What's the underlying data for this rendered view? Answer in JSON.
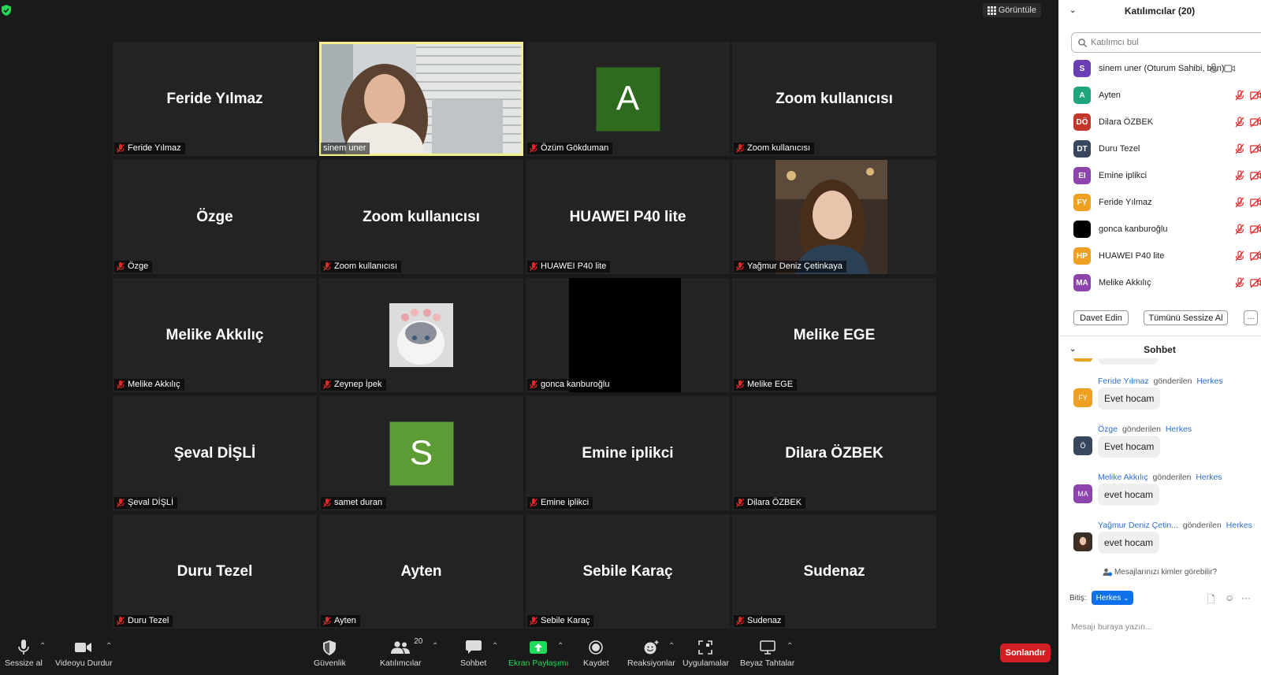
{
  "meeting": {
    "view_label": "Görüntüle",
    "tiles": [
      {
        "display": "Feride Yılmaz",
        "label": "Feride Yılmaz",
        "muted": true,
        "kind": "name"
      },
      {
        "display": "",
        "label": "sinem uner",
        "muted": false,
        "kind": "video",
        "active": true
      },
      {
        "display": "A",
        "label": "Özüm Gökduman",
        "muted": true,
        "kind": "letter",
        "color": "#2f6b1f"
      },
      {
        "display": "Zoom kullanıcısı",
        "label": "Zoom kullanıcısı",
        "muted": true,
        "kind": "name"
      },
      {
        "display": "Özge",
        "label": "Özge",
        "muted": true,
        "kind": "name"
      },
      {
        "display": "Zoom kullanıcısı",
        "label": "Zoom kullanıcısı",
        "muted": true,
        "kind": "name"
      },
      {
        "display": "HUAWEI P40 lite",
        "label": "HUAWEI P40 lite",
        "muted": true,
        "kind": "name"
      },
      {
        "display": "",
        "label": "Yağmur Deniz Çetinkaya",
        "muted": true,
        "kind": "portrait"
      },
      {
        "display": "Melike Akkılıç",
        "label": "Melike Akkılıç",
        "muted": true,
        "kind": "name"
      },
      {
        "display": "",
        "label": "Zeynep İpek",
        "muted": true,
        "kind": "cat"
      },
      {
        "display": "",
        "label": "gonca kanburoğlu",
        "muted": true,
        "kind": "black"
      },
      {
        "display": "Melike EGE",
        "label": "Melike EGE",
        "muted": true,
        "kind": "name"
      },
      {
        "display": "Şeval DİŞLİ",
        "label": "Şeval DİŞLİ",
        "muted": true,
        "kind": "name"
      },
      {
        "display": "S",
        "label": "samet duran",
        "muted": true,
        "kind": "letter",
        "color": "#5d9b34"
      },
      {
        "display": "Emine iplikci",
        "label": "Emine iplikci",
        "muted": true,
        "kind": "name"
      },
      {
        "display": "Dilara ÖZBEK",
        "label": "Dilara ÖZBEK",
        "muted": true,
        "kind": "name"
      },
      {
        "display": "Duru Tezel",
        "label": "Duru Tezel",
        "muted": true,
        "kind": "name"
      },
      {
        "display": "Ayten",
        "label": "Ayten",
        "muted": true,
        "kind": "name"
      },
      {
        "display": "Sebile Karaç",
        "label": "Sebile Karaç",
        "muted": true,
        "kind": "name"
      },
      {
        "display": "Sudenaz",
        "label": "Sudenaz",
        "muted": true,
        "kind": "name"
      }
    ]
  },
  "toolbar": {
    "mute_label": "Sessize al",
    "video_label": "Videoyu Durdur",
    "security_label": "Güvenlik",
    "participants_label": "Katılımcılar",
    "participants_count": "20",
    "chat_label": "Sohbet",
    "share_label": "Ekran Paylaşımı",
    "record_label": "Kaydet",
    "reactions_label": "Reaksiyonlar",
    "apps_label": "Uygulamalar",
    "whiteboard_label": "Beyaz Tahtalar",
    "end_label": "Sonlandır",
    "share_color": "#23d959",
    "end_color": "#d11f23"
  },
  "participants": {
    "title": "Katılımcılar (20)",
    "search_placeholder": "Katılımcı bul",
    "items": [
      {
        "initials": "S",
        "name": "sinem uner (Oturum Sahibi, ben)",
        "color": "#6a3fb5",
        "muted": false
      },
      {
        "initials": "A",
        "name": "Ayten",
        "color": "#1fa57e",
        "muted": true
      },
      {
        "initials": "DÖ",
        "name": "Dilara ÖZBEK",
        "color": "#c4352b",
        "muted": true
      },
      {
        "initials": "DT",
        "name": "Duru Tezel",
        "color": "#38475e",
        "muted": true
      },
      {
        "initials": "EI",
        "name": "Emine iplikci",
        "color": "#8e44ad",
        "muted": true
      },
      {
        "initials": "FY",
        "name": "Feride Yılmaz",
        "color": "#f0a020",
        "muted": true
      },
      {
        "initials": "",
        "name": "gonca kanburoğlu",
        "color": "#000000",
        "muted": true
      },
      {
        "initials": "HP",
        "name": "HUAWEI P40 lite",
        "color": "#f0a020",
        "muted": true
      },
      {
        "initials": "MA",
        "name": "Melike Akkılıç",
        "color": "#8e44ad",
        "muted": true
      }
    ],
    "invite_label": "Davet Edin",
    "mute_all_label": "Tümünü Sessize Al",
    "more_label": "···"
  },
  "chat": {
    "title": "Sohbet",
    "sent_word": "gönderilen",
    "messages": [
      {
        "sender": "Feride Yılmaz",
        "to": "Herkes",
        "text": "Evet hocam",
        "initials": "FY",
        "color": "#f0a020"
      },
      {
        "sender": "Özge",
        "to": "Herkes",
        "text": "Evet hocam",
        "initials": "Ö",
        "color": "#38475e"
      },
      {
        "sender": "Melike Akkılıç",
        "to": "Herkes",
        "text": "evet hocam",
        "initials": "MA",
        "color": "#8e44ad"
      },
      {
        "sender": "Yağmur Deniz Çetin...",
        "to": "Herkes",
        "text": "evet hocam",
        "initials": "",
        "color": "#6b4a3a"
      }
    ],
    "who_can_see": "Mesajlarınızı kimler görebilir?",
    "to_label": "Bitiş:",
    "to_value": "Herkes",
    "input_placeholder": "Mesajı buraya yazın..."
  }
}
